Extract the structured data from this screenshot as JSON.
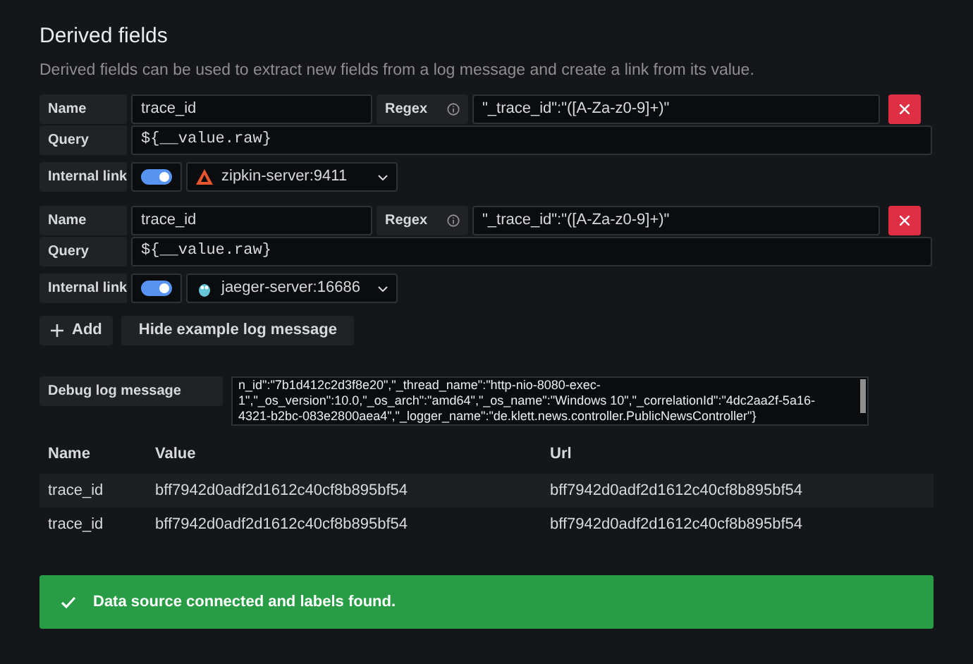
{
  "title": "Derived fields",
  "description": "Derived fields can be used to extract new fields from a log message and create a link from its value.",
  "fields": [
    {
      "name_label": "Name",
      "name": "trace_id",
      "regex_label": "Regex",
      "regex": "\"_trace_id\":\"([A-Za-z0-9]+)\"",
      "query_label": "Query",
      "query": "${__value.raw}",
      "link_label": "Internal link",
      "internal_link": true,
      "datasource": "zipkin-server:9411",
      "kind": "zipkin"
    },
    {
      "name_label": "Name",
      "name": "trace_id",
      "regex_label": "Regex",
      "regex": "\"_trace_id\":\"([A-Za-z0-9]+)\"",
      "query_label": "Query",
      "query": "${__value.raw}",
      "link_label": "Internal link",
      "internal_link": true,
      "datasource": "jaeger-server:16686",
      "kind": "jaeger"
    }
  ],
  "buttons": {
    "add": "Add",
    "hide": "Hide example log message"
  },
  "debug": {
    "label": "Debug log message",
    "lines": [
      "n_id\":\"7b1d412c2d3f8e20\",\"_thread_name\":\"http-nio-8080-exec-",
      "1\",\"_os_version\":10.0,\"_os_arch\":\"amd64\",\"_os_name\":\"Windows 10\",\"_correlationId\":\"4dc2aa2f-5a16-",
      "4321-b2bc-083e2800aea4\",\"_logger_name\":\"de.klett.news.controller.PublicNewsController\"}"
    ]
  },
  "table": {
    "columns": [
      "Name",
      "Value",
      "Url"
    ],
    "rows": [
      [
        "trace_id",
        "bff7942d0adf2d1612c40cf8b895bf54",
        "bff7942d0adf2d1612c40cf8b895bf54"
      ],
      [
        "trace_id",
        "bff7942d0adf2d1612c40cf8b895bf54",
        "bff7942d0adf2d1612c40cf8b895bf54"
      ]
    ]
  },
  "alert": {
    "text": "Data source connected and labels found."
  }
}
